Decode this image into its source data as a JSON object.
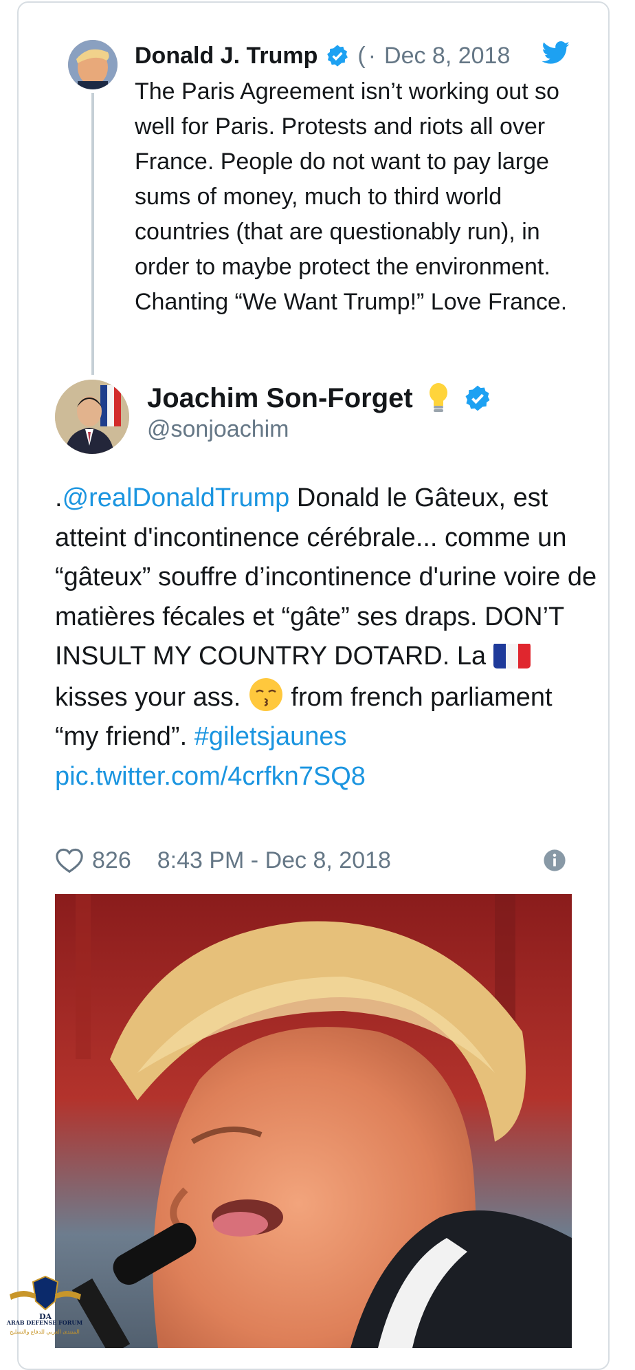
{
  "quoted_tweet": {
    "author_name": "Donald J. Trump",
    "handle_fragment": "(",
    "separator": "·",
    "date": "Dec 8, 2018",
    "text": "The Paris Agreement isn’t working out so well for Paris. Protests and riots all over France. People do not want to pay large sums of money, much to third world countries (that are questionably run), in order to maybe protect the environment. Chanting “We Want Trump!” Love France."
  },
  "reply": {
    "author_name": "Joachim Son-Forget",
    "handle": "@sonjoachim",
    "body": {
      "prefix": ".",
      "mention": "@realDonaldTrump",
      "part1": " Donald le Gâteux, est atteint d'incontinence cérébrale... comme un “gâteux” souffre d’incontinence d'urine voire de matières fécales et “gâte” ses draps. DON’T INSULT MY COUNTRY DOTARD. La ",
      "part2": " kisses your ass. ",
      "part3": " from french parliament “my friend”. ",
      "hashtag": "#giletsjaunes",
      "pic_link": "pic.twitter.com/4crfkn7SQ8"
    },
    "likes": "826",
    "timestamp": "8:43 PM - Dec 8, 2018"
  },
  "watermark": {
    "logo_text": "DA",
    "name": "ARAB DEFENSE FORUM",
    "arabic": "المنتدى العربي للدفاع والتسليح"
  },
  "colors": {
    "link": "#1b95e0",
    "verified": "#1da1f2",
    "secondary_text": "#657786",
    "border": "#d7dde2"
  },
  "icons": [
    "twitter-bird-icon",
    "verified-badge-icon",
    "lightbulb-emoji-icon",
    "france-flag-emoji-icon",
    "kissing-face-emoji-icon",
    "heart-icon",
    "info-icon"
  ]
}
